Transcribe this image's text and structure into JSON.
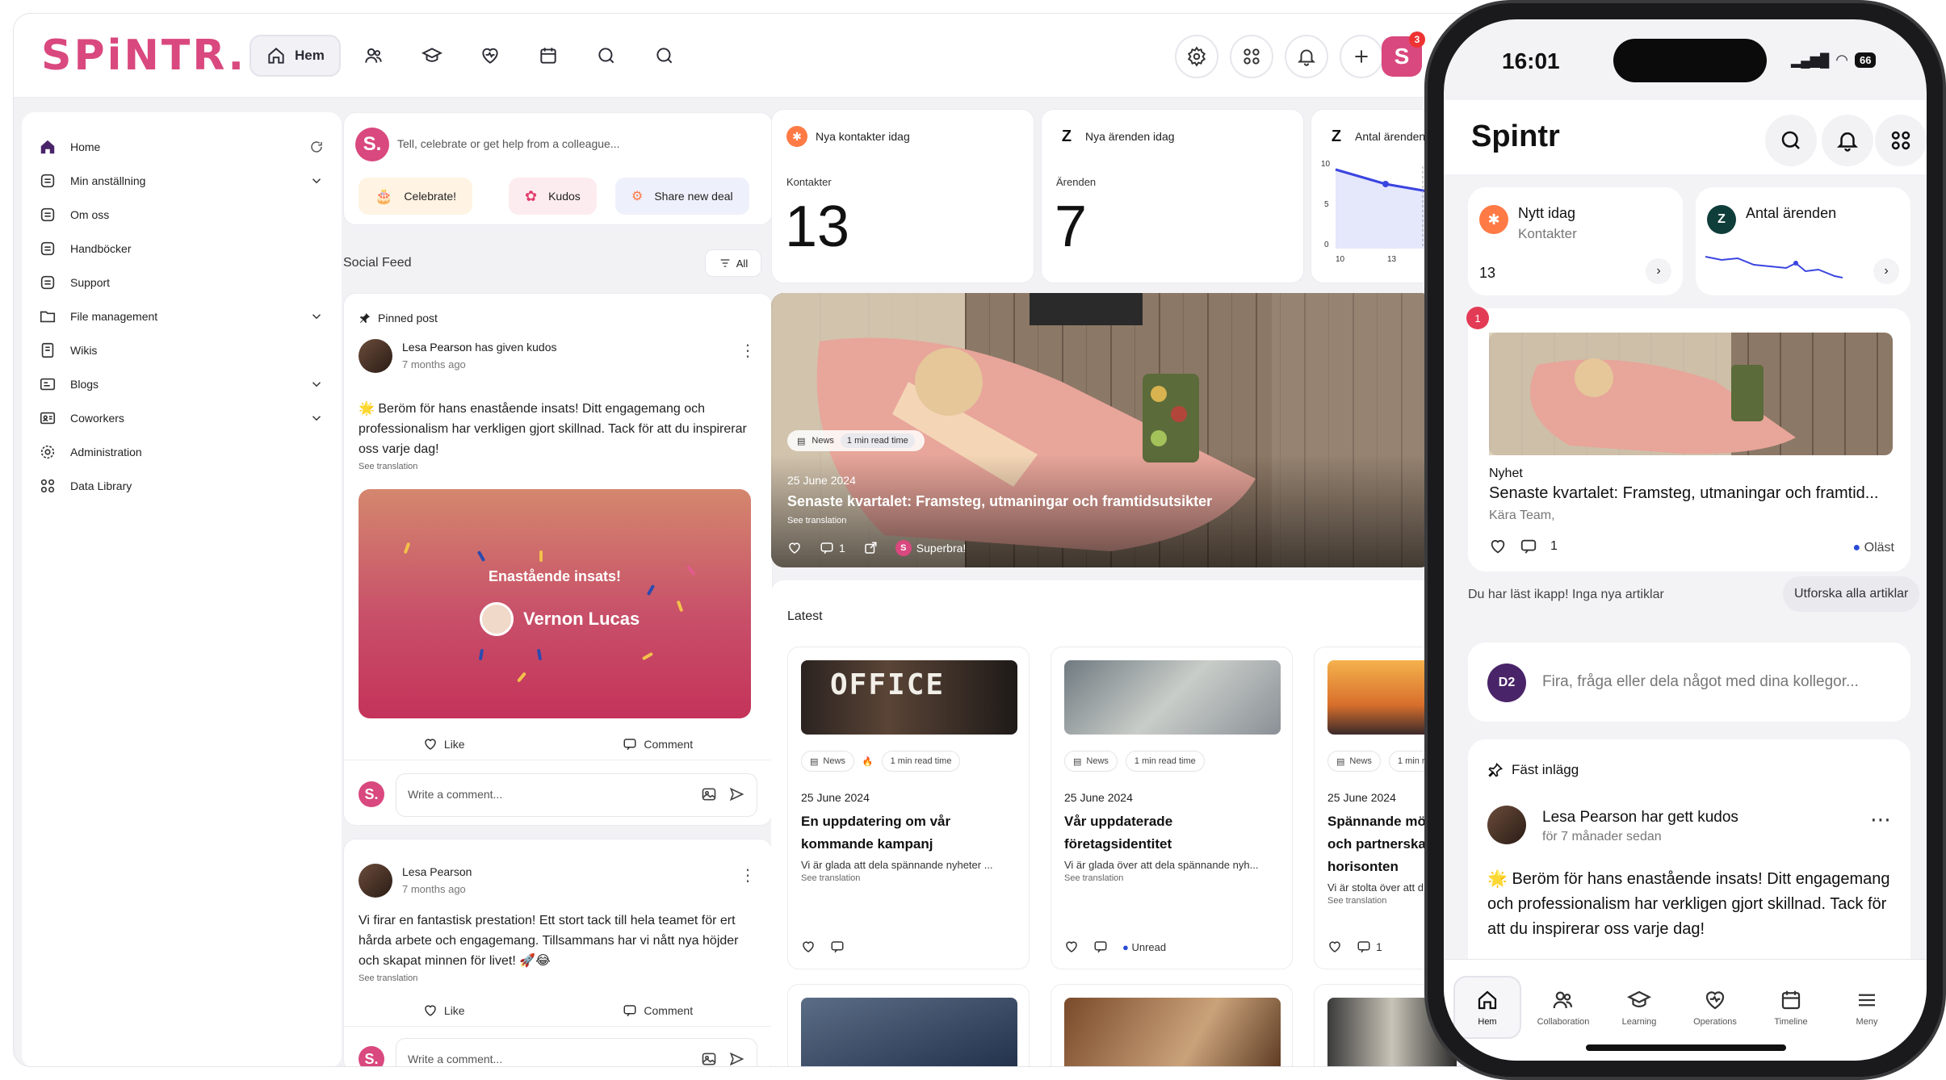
{
  "desktop": {
    "logo": "SPiNTR.",
    "nav": {
      "home_label": "Hem"
    },
    "avatar_letter": "S",
    "avatar_badge": "3"
  },
  "sidebar": {
    "items": [
      {
        "label": "Home"
      },
      {
        "label": "Min anställning"
      },
      {
        "label": "Om oss"
      },
      {
        "label": "Handböcker"
      },
      {
        "label": "Support"
      },
      {
        "label": "File management"
      },
      {
        "label": "Wikis"
      },
      {
        "label": "Blogs"
      },
      {
        "label": "Coworkers"
      },
      {
        "label": "Administration"
      },
      {
        "label": "Data Library"
      }
    ]
  },
  "composer": {
    "avatar_letter": "S.",
    "placeholder": "Tell, celebrate or get help from a colleague...",
    "celebrate": "Celebrate!",
    "kudos": "Kudos",
    "share_deal": "Share new deal"
  },
  "feed": {
    "label": "Social Feed",
    "filter": "All",
    "post1": {
      "pinned": "Pinned post",
      "author": "Lesa Pearson",
      "action": "has given kudos",
      "time": "7 months ago",
      "body": "Beröm för hans enastående insats! Ditt engagemang och professionalism har verkligen gjort skillnad. Tack för att du inspirerar oss varje dag!",
      "see_translation": "See translation",
      "kudos_title": "Enastående insats!",
      "kudos_person": "Vernon Lucas",
      "like": "Like",
      "comment": "Comment",
      "write": "Write a comment..."
    },
    "post2": {
      "author": "Lesa Pearson",
      "time": "7 months ago",
      "body": "Vi firar en fantastisk prestation! Ett stort tack till hela teamet för ert hårda arbete och engagemang. Tillsammans har vi nått nya höjder och skapat minnen för livet! 🚀😂",
      "see_translation": "See translation",
      "like": "Like",
      "comment": "Comment",
      "write": "Write a comment..."
    }
  },
  "stats": [
    {
      "title": "Nya kontakter idag",
      "sub": "Kontakter",
      "value": "13"
    },
    {
      "title": "Nya ärenden idag",
      "sub": "Ärenden",
      "value": "7"
    },
    {
      "title": "Antal ärenden",
      "y_ticks": [
        "10",
        "5",
        "0"
      ],
      "x_ticks": [
        "10",
        "13"
      ]
    }
  ],
  "hero": {
    "tag": "News",
    "read": "1 min read time",
    "date": "25 June 2024",
    "title": "Senaste kvartalet: Framsteg, utmaningar och framtidsutsikter",
    "see_translation": "See translation",
    "comments": "1",
    "reaction": "Superbra!"
  },
  "latest": {
    "label": "Latest",
    "cards": [
      {
        "tag": "News",
        "read": "1 min read time",
        "date": "25 June 2024",
        "title": "En uppdatering om vår kommande kampanj",
        "excerpt": "Vi är glada att dela spännande nyheter ...",
        "see_translation": "See translation",
        "img_text": "OFFICE"
      },
      {
        "tag": "News",
        "read": "1 min read time",
        "date": "25 June 2024",
        "title": "Vår uppdaterade företagsidentitet",
        "excerpt": "Vi är glada över att dela spännande nyh...",
        "see_translation": "See translation",
        "status": "Unread"
      },
      {
        "tag": "News",
        "read": "1 min re",
        "date": "25 June 2024",
        "title": "Spännande mö och partnerska horisonten",
        "excerpt": "Vi är stolta över att d",
        "see_translation": "See translation",
        "comments": "1"
      }
    ]
  },
  "phone": {
    "time": "16:01",
    "battery": "66",
    "brand": "Spintr",
    "widget1": {
      "title": "Nytt idag",
      "sub": "Kontakter",
      "value": "13"
    },
    "widget2": {
      "title": "Antal ärenden"
    },
    "news": {
      "badge": "1",
      "category": "Nyhet",
      "title": "Senaste kvartalet: Framsteg, utmaningar och framtid...",
      "sub": "Kära Team,",
      "comments": "1",
      "status": "Oläst"
    },
    "read_all": "Du har läst ikapp! Inga nya artiklar",
    "explore": "Utforska alla artiklar",
    "composer_avatar": "D2",
    "composer_placeholder": "Fira, fråga eller dela något med dina kollegor...",
    "pinned": "Fäst inlägg",
    "post_author": "Lesa Pearson har gett kudos",
    "post_time": "för 7 månader sedan",
    "post_body": "Beröm för hans enastående insats! Ditt engagemang och professionalism har verkligen gjort skillnad. Tack för att du inspirerar oss varje dag!",
    "nav": [
      {
        "label": "Hem"
      },
      {
        "label": "Collaboration"
      },
      {
        "label": "Learning"
      },
      {
        "label": "Operations"
      },
      {
        "label": "Timeline"
      },
      {
        "label": "Meny"
      }
    ]
  }
}
